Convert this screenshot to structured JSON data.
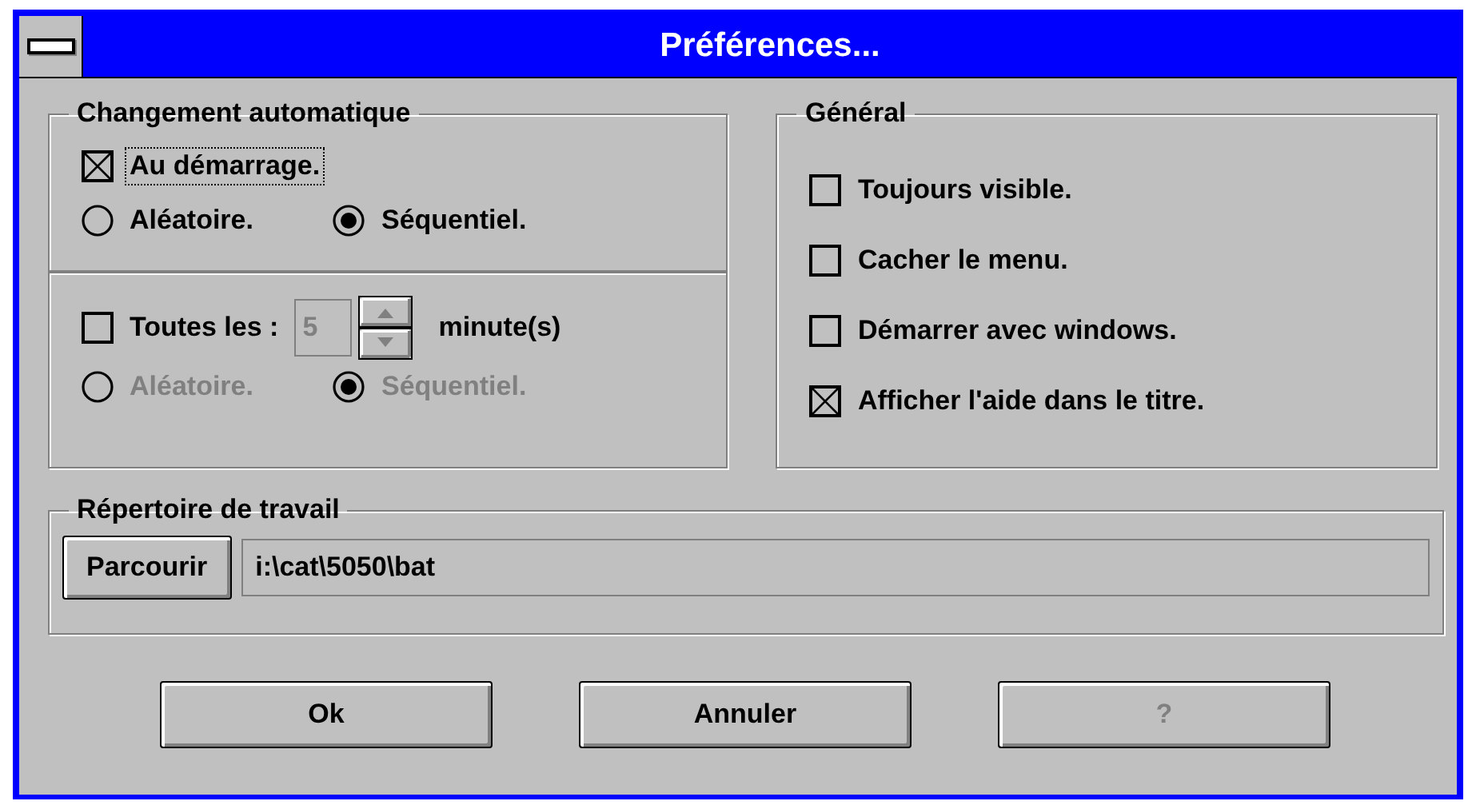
{
  "window": {
    "title": "Préférences..."
  },
  "auto_change": {
    "title": "Changement automatique",
    "startup": {
      "label": "Au démarrage.",
      "checked": true,
      "focused": true
    },
    "order_options": [
      {
        "label": "Aléatoire.",
        "selected": false,
        "disabled": false
      },
      {
        "label": "Séquentiel.",
        "selected": true,
        "disabled": false
      }
    ],
    "interval": {
      "label": "Toutes les :",
      "checked": false,
      "value": "5",
      "unit": "minute(s)",
      "disabled": true
    },
    "interval_order_options": [
      {
        "label": "Aléatoire.",
        "selected": false,
        "disabled": true
      },
      {
        "label": "Séquentiel.",
        "selected": true,
        "disabled": true
      }
    ]
  },
  "general": {
    "title": "Général",
    "options": [
      {
        "label": "Toujours visible.",
        "checked": false
      },
      {
        "label": "Cacher le menu.",
        "checked": false
      },
      {
        "label": "Démarrer avec windows.",
        "checked": false
      },
      {
        "label": "Afficher l'aide dans le titre.",
        "checked": true
      }
    ]
  },
  "work_dir": {
    "title": "Répertoire de travail",
    "browse_button": "Parcourir",
    "path": "i:\\cat\\5050\\bat"
  },
  "buttons": [
    {
      "label": "Ok",
      "disabled": false
    },
    {
      "label": "Annuler",
      "disabled": false
    },
    {
      "label": "?",
      "disabled": true
    }
  ]
}
